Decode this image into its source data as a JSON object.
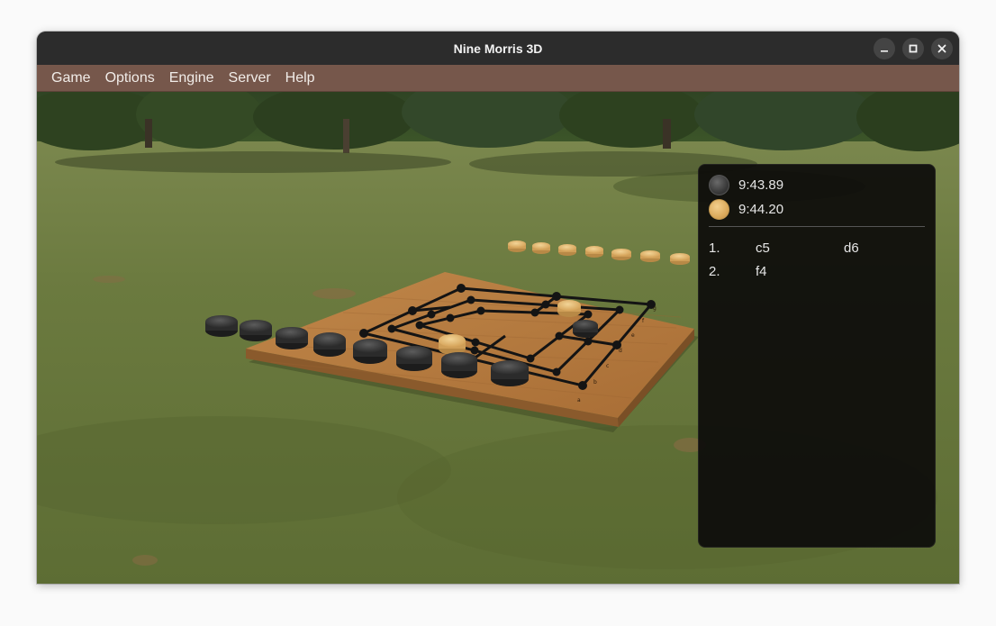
{
  "window": {
    "title": "Nine Morris 3D"
  },
  "menu": [
    {
      "label": "Game"
    },
    {
      "label": "Options"
    },
    {
      "label": "Engine"
    },
    {
      "label": "Server"
    },
    {
      "label": "Help"
    }
  ],
  "timers": {
    "black": "9:43.89",
    "white": "9:44.20"
  },
  "moves": [
    {
      "num": "1.",
      "white": "c5",
      "black": "d6"
    },
    {
      "num": "2.",
      "white": "f4",
      "black": ""
    }
  ],
  "board": {
    "file_labels": [
      "a",
      "b",
      "c",
      "d",
      "e",
      "f",
      "g"
    ],
    "rank_labels": [
      "1",
      "2",
      "3",
      "4",
      "5",
      "6",
      "7"
    ],
    "pieces_on_board": {
      "white": [
        "c5",
        "f4"
      ],
      "black": [
        "d6"
      ]
    },
    "reserve": {
      "white": 7,
      "black": 8
    }
  },
  "icons": {
    "minimize": "minimize-icon",
    "maximize": "maximize-icon",
    "close": "close-icon"
  },
  "colors": {
    "menubar": "#76574b",
    "titlebar": "#2c2c2c",
    "panel": "#0c0b0a",
    "board": "#b0773e",
    "white_piece": "#e0b26a",
    "black_piece": "#2b2b2b"
  }
}
